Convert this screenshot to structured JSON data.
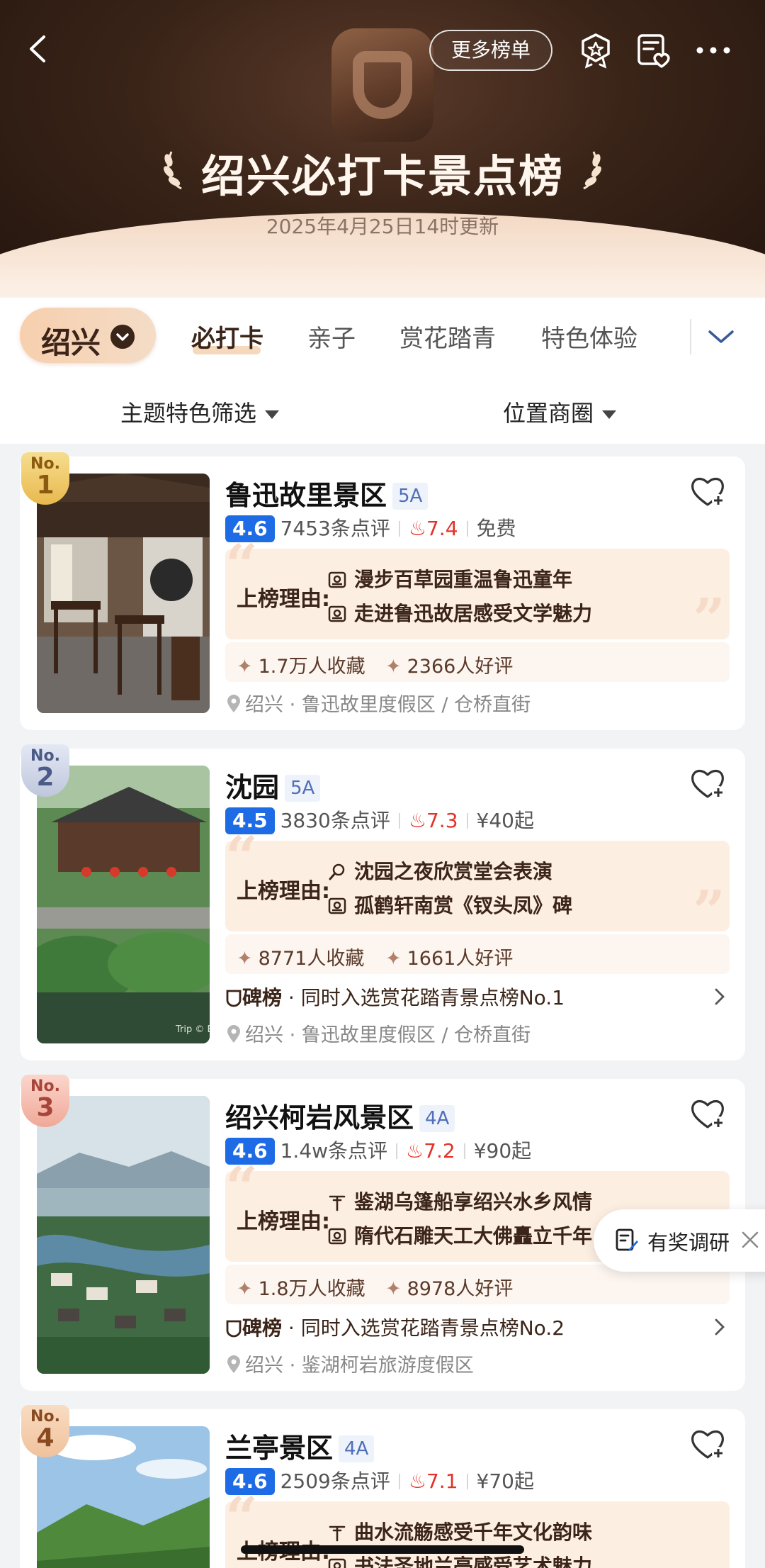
{
  "header": {
    "more_lists": "更多榜单",
    "title": "绍兴必打卡景点榜",
    "updated": "2025年4月25日14时更新"
  },
  "city": "绍兴",
  "tabs": [
    "必打卡",
    "亲子",
    "赏花踏青",
    "特色体验"
  ],
  "filters": {
    "theme": "主题特色筛选",
    "location": "位置商圈"
  },
  "reason_label": "上榜理由:",
  "cards": [
    {
      "rank_prefix": "No.",
      "rank": "1",
      "name": "鲁迅故里景区",
      "grade": "5A",
      "score": "4.6",
      "reviews": "7453条点评",
      "heat": "7.4",
      "price": "免费",
      "reasons": [
        "漫步百草园重温鲁迅童年",
        "走进鲁迅故居感受文学魅力"
      ],
      "saves": "1.7万人收藏",
      "good": "2366人好评",
      "board": "",
      "location": "绍兴 · 鲁迅故里度假区 / 仓桥直街"
    },
    {
      "rank_prefix": "No.",
      "rank": "2",
      "name": "沈园",
      "grade": "5A",
      "score": "4.5",
      "reviews": "3830条点评",
      "heat": "7.3",
      "price": "¥40起",
      "reasons": [
        "沈园之夜欣赏堂会表演",
        "孤鹤轩南赏《钗头凤》碑"
      ],
      "saves": "8771人收藏",
      "good": "1661人好评",
      "board_name": "碑榜",
      "board": " · 同时入选赏花踏青景点榜No.1",
      "location": "绍兴 · 鲁迅故里度假区 / 仓桥直街",
      "watermark": "Trip © E"
    },
    {
      "rank_prefix": "No.",
      "rank": "3",
      "name": "绍兴柯岩风景区",
      "grade": "4A",
      "score": "4.6",
      "reviews": "1.4w条点评",
      "heat": "7.2",
      "price": "¥90起",
      "reasons": [
        "鉴湖乌篷船享绍兴水乡风情",
        "隋代石雕天工大佛矗立千年"
      ],
      "saves": "1.8万人收藏",
      "good": "8978人好评",
      "board_name": "碑榜",
      "board": " · 同时入选赏花踏青景点榜No.2",
      "location": "绍兴 · 鉴湖柯岩旅游度假区"
    },
    {
      "rank_prefix": "No.",
      "rank": "4",
      "name": "兰亭景区",
      "grade": "4A",
      "score": "4.6",
      "reviews": "2509条点评",
      "heat": "7.1",
      "price": "¥70起",
      "reasons": [
        "曲水流觞感受千年文化韵味",
        "书法圣地兰亭感受艺术魅力"
      ]
    }
  ],
  "survey": "有奖调研",
  "colors": {
    "header_bg": "#3a2418",
    "score_blue": "#1e6be6",
    "heat_red": "#e2332a",
    "reason_bg": "#fdeee2",
    "gold": "#e8c46a",
    "silver": "#c9cfe0",
    "bronze": "#f2b6a8"
  }
}
